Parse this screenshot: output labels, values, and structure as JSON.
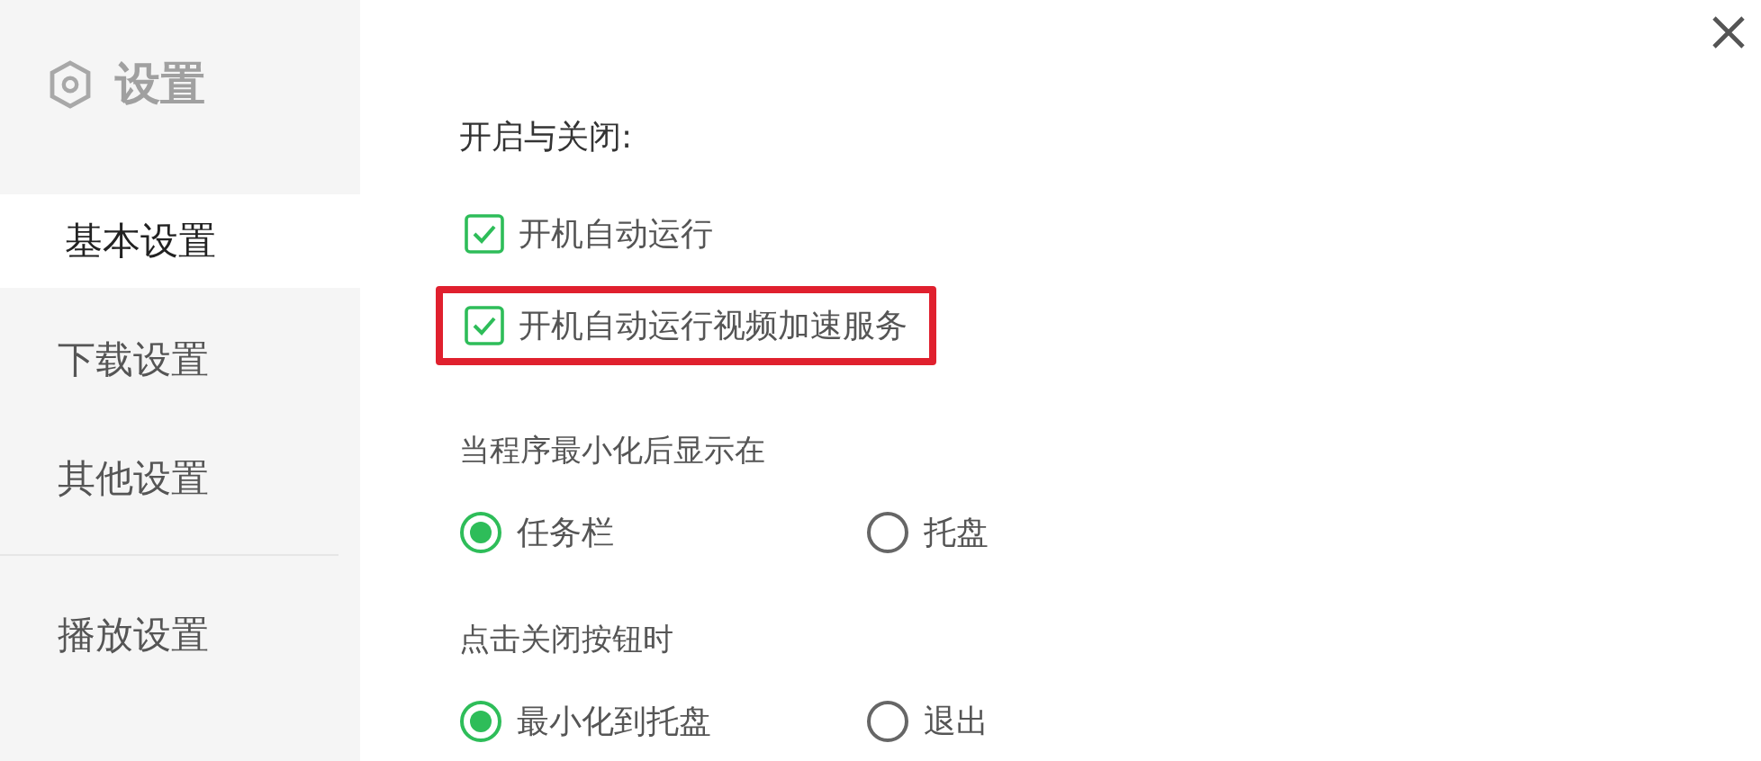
{
  "sidebar": {
    "title": "设置",
    "groups": [
      [
        {
          "label": "基本设置",
          "selected": true
        },
        {
          "label": "下载设置",
          "selected": false
        },
        {
          "label": "其他设置",
          "selected": false
        }
      ],
      [
        {
          "label": "播放设置",
          "selected": false
        }
      ]
    ]
  },
  "section": {
    "title": "开启与关闭:",
    "checkboxes": [
      {
        "label": "开机自动运行",
        "checked": true,
        "highlighted": false
      },
      {
        "label": "开机自动运行视频加速服务",
        "checked": true,
        "highlighted": true
      }
    ],
    "radio_groups": [
      {
        "label": "当程序最小化后显示在",
        "options": [
          {
            "label": "任务栏",
            "selected": true
          },
          {
            "label": "托盘",
            "selected": false
          }
        ]
      },
      {
        "label": "点击关闭按钮时",
        "options": [
          {
            "label": "最小化到托盘",
            "selected": true
          },
          {
            "label": "退出",
            "selected": false
          }
        ]
      }
    ]
  }
}
